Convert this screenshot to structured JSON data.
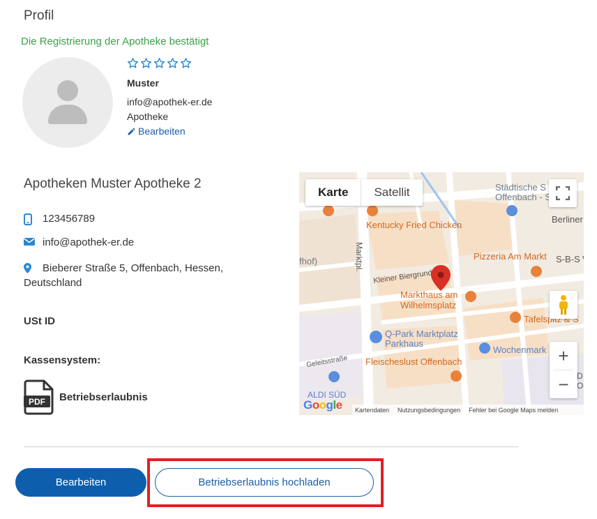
{
  "profile": {
    "title": "Profil",
    "verified_text": "Die Registrierung der Apotheke bestätigt",
    "name": "Muster",
    "email": "info@apothek-er.de",
    "role": "Apotheke",
    "edit_link": "Bearbeiten",
    "rating": 0,
    "rating_max": 5
  },
  "pharmacy": {
    "name": "Apotheken Muster Apotheke 2",
    "phone": "123456789",
    "email": "info@apothek-er.de",
    "address_line1": "Bieberer Straße 5, Offenbach, Hessen,",
    "address_line2": "Deutschland",
    "ust_label": "USt ID",
    "kassen_label": "Kassensystem:",
    "document_label": "Betriebserlaubnis",
    "document_type": "PDF"
  },
  "map": {
    "type_map": "Karte",
    "type_satellite": "Satellit",
    "labels": {
      "staedtische": "Städtische S",
      "offenbach": "Offenbach - S",
      "berliner": "Berliner",
      "kfc": "Kentucky Fried Chicken",
      "pizzeria": "Pizzeria Am Markt",
      "sbs": "S-B-S W",
      "hof": "fhof)",
      "marktpl": "Marktpl.",
      "biergrund": "Kleiner Biergrund",
      "markthaus1": "Markthaus am",
      "markthaus2": "Wilhelmsplatz",
      "tafelspitz": "Tafelspitz & S",
      "qpark1": "Q-Park Marktplatz",
      "qpark2": "Parkhaus",
      "geleits": "Geleitsstraße",
      "wochenmarkt": "Wochenmark",
      "fleisches": "Fleischeslust Offenbach",
      "aldi": "ALDI SÜD",
      "d": "D",
      "o": "Os",
      "g": "G"
    },
    "footer": {
      "kartendaten": "Kartendaten",
      "nutzung": "Nutzungsbedingungen",
      "fehler": "Fehler bei Google Maps melden"
    },
    "logo": "Google"
  },
  "actions": {
    "edit_button": "Bearbeiten",
    "upload_button": "Betriebserlaubnis hochladen"
  },
  "colors": {
    "primary": "#0d5fae",
    "link": "#1a5fa6",
    "success": "#3aa24a",
    "highlight": "#e31e24",
    "poi_orange": "#e8823a",
    "poi_blue": "#5b8fdd",
    "pin_red": "#d93025"
  }
}
